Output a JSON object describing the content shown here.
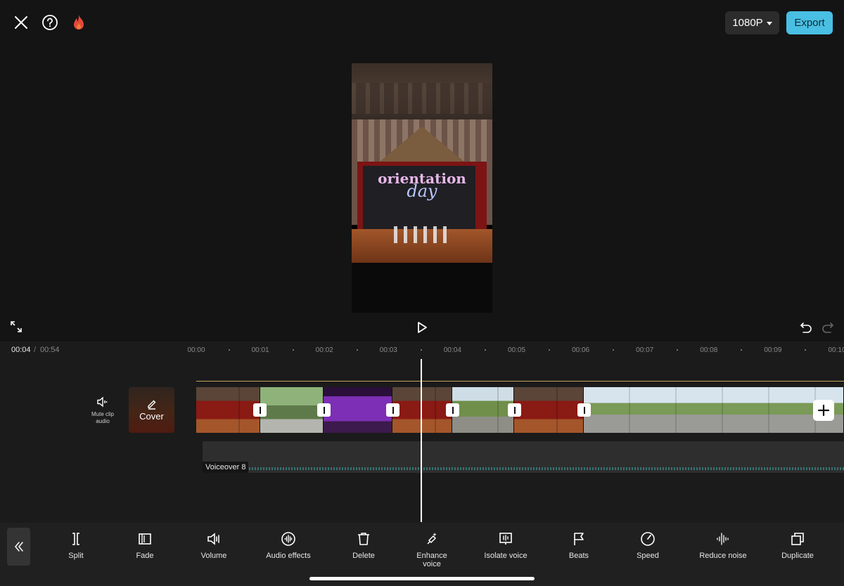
{
  "header": {
    "close_icon": "close-icon",
    "help_icon": "help-icon",
    "fire_icon": "fire-icon",
    "resolution": "1080P",
    "export_label": "Export",
    "accent_color": "#49bfe3"
  },
  "preview": {
    "title_line1": "orientation",
    "title_line2": "day"
  },
  "playback": {
    "current_time": "00:04",
    "separator": "/",
    "total_time": "00:54"
  },
  "ruler": {
    "labels": [
      "00:00",
      "00:01",
      "00:02",
      "00:03",
      "00:04",
      "00:05",
      "00:06",
      "00:07",
      "00:08",
      "00:09",
      "00:10"
    ]
  },
  "track": {
    "mute_label": "Mute clip audio",
    "cover_label": "Cover",
    "voiceover_label": "Voiceover 8"
  },
  "toolbar": {
    "items": [
      {
        "label": "Split",
        "icon": "split-icon"
      },
      {
        "label": "Fade",
        "icon": "fade-icon"
      },
      {
        "label": "Volume",
        "icon": "volume-icon"
      },
      {
        "label": "Audio effects",
        "icon": "audio-effects-icon"
      },
      {
        "label": "Delete",
        "icon": "delete-icon"
      },
      {
        "label": "Enhance voice",
        "icon": "enhance-voice-icon"
      },
      {
        "label": "Isolate voice",
        "icon": "isolate-voice-icon"
      },
      {
        "label": "Beats",
        "icon": "beats-icon"
      },
      {
        "label": "Speed",
        "icon": "speed-icon"
      },
      {
        "label": "Reduce noise",
        "icon": "reduce-noise-icon"
      },
      {
        "label": "Duplicate",
        "icon": "duplicate-icon"
      }
    ]
  }
}
